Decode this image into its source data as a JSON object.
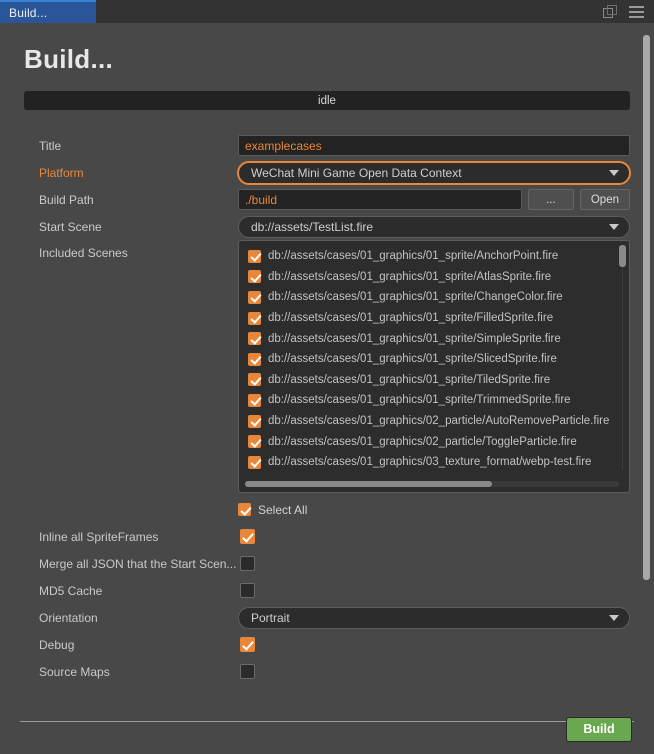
{
  "window": {
    "tab_label": "Build...",
    "popout_icon": "popout-icon",
    "menu_icon": "hamburger-menu-icon"
  },
  "header": {
    "title": "Build..."
  },
  "status": {
    "text": "idle"
  },
  "colors": {
    "accent_orange": "#e8873a",
    "tab_blue": "#2a5699",
    "build_green": "#6aa84f",
    "panel_dark": "#2d2d2d",
    "page_bg": "#484848"
  },
  "form": {
    "title": {
      "label": "Title",
      "value": "examplecases"
    },
    "platform": {
      "label": "Platform",
      "value": "WeChat Mini Game Open Data Context"
    },
    "build_path": {
      "label": "Build Path",
      "value": "./build",
      "browse_label": "...",
      "open_label": "Open"
    },
    "start_scene": {
      "label": "Start Scene",
      "value": "db://assets/TestList.fire"
    },
    "included_scenes": {
      "label": "Included Scenes",
      "items": [
        {
          "path": "db://assets/cases/01_graphics/01_sprite/AnchorPoint.fire",
          "checked": true
        },
        {
          "path": "db://assets/cases/01_graphics/01_sprite/AtlasSprite.fire",
          "checked": true
        },
        {
          "path": "db://assets/cases/01_graphics/01_sprite/ChangeColor.fire",
          "checked": true
        },
        {
          "path": "db://assets/cases/01_graphics/01_sprite/FilledSprite.fire",
          "checked": true
        },
        {
          "path": "db://assets/cases/01_graphics/01_sprite/SimpleSprite.fire",
          "checked": true
        },
        {
          "path": "db://assets/cases/01_graphics/01_sprite/SlicedSprite.fire",
          "checked": true
        },
        {
          "path": "db://assets/cases/01_graphics/01_sprite/TiledSprite.fire",
          "checked": true
        },
        {
          "path": "db://assets/cases/01_graphics/01_sprite/TrimmedSprite.fire",
          "checked": true
        },
        {
          "path": "db://assets/cases/01_graphics/02_particle/AutoRemoveParticle.fire",
          "checked": true
        },
        {
          "path": "db://assets/cases/01_graphics/02_particle/ToggleParticle.fire",
          "checked": true
        },
        {
          "path": "db://assets/cases/01_graphics/03_texture_format/webp-test.fire",
          "checked": true
        }
      ]
    },
    "select_all": {
      "label": "Select All",
      "checked": true
    },
    "inline_spriteframes": {
      "label": "Inline all SpriteFrames",
      "checked": true
    },
    "merge_json": {
      "label": "Merge all JSON that the Start Scen...",
      "checked": false
    },
    "md5_cache": {
      "label": "MD5 Cache",
      "checked": false
    },
    "orientation": {
      "label": "Orientation",
      "value": "Portrait"
    },
    "debug": {
      "label": "Debug",
      "checked": true
    },
    "source_maps": {
      "label": "Source Maps",
      "checked": false
    }
  },
  "footer": {
    "build_label": "Build"
  }
}
